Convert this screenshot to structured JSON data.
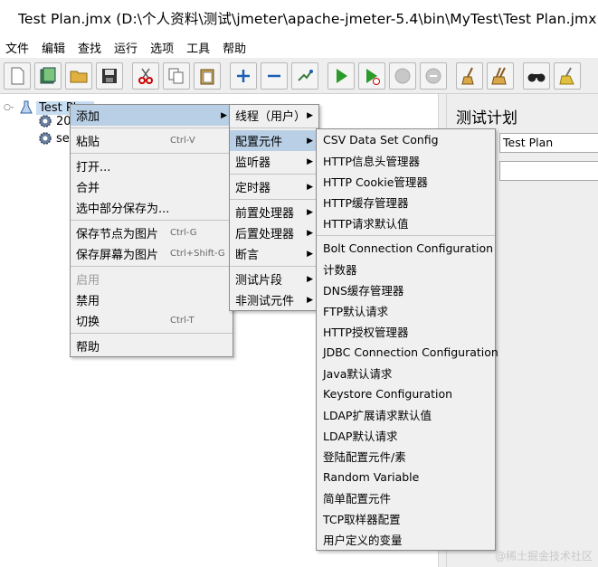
{
  "window": {
    "title": "Test Plan.jmx (D:\\个人资料\\测试\\jmeter\\apache-jmeter-5.4\\bin\\MyTest\\Test Plan.jmx) - A"
  },
  "menubar": [
    "文件",
    "编辑",
    "查找",
    "运行",
    "选项",
    "工具",
    "帮助"
  ],
  "toolbar": {
    "icons": [
      "new-icon",
      "templates-icon",
      "open-icon",
      "save-icon",
      "cut-icon",
      "copy-icon",
      "paste-icon",
      "expand-icon",
      "collapse-icon",
      "toggle-icon",
      "start-icon",
      "start-no-pause-icon",
      "stop-icon",
      "shutdown-icon",
      "clear-icon",
      "clear-all-icon",
      "search-icon",
      "reset-search-icon"
    ]
  },
  "tree": {
    "root": "Test Plan",
    "children": [
      "20",
      "se"
    ]
  },
  "right_panel": {
    "title": "测试计划",
    "name_value": "Test Plan",
    "comment_value": ""
  },
  "context_menu": [
    {
      "label": "添加",
      "submenu": true,
      "highlight": true
    },
    {
      "sep": true
    },
    {
      "label": "粘贴",
      "accel": "Ctrl-V"
    },
    {
      "sep": true
    },
    {
      "label": "打开..."
    },
    {
      "label": "合并"
    },
    {
      "label": "选中部分保存为..."
    },
    {
      "sep": true
    },
    {
      "label": "保存节点为图片",
      "accel": "Ctrl-G"
    },
    {
      "label": "保存屏幕为图片",
      "accel": "Ctrl+Shift-G"
    },
    {
      "sep": true
    },
    {
      "label": "启用",
      "disabled": true
    },
    {
      "label": "禁用"
    },
    {
      "label": "切换",
      "accel": "Ctrl-T"
    },
    {
      "sep": true
    },
    {
      "label": "帮助"
    }
  ],
  "add_submenu": [
    {
      "label": "线程（用户）",
      "submenu": true
    },
    {
      "sep": true
    },
    {
      "label": "配置元件",
      "submenu": true,
      "highlight": true
    },
    {
      "label": "监听器",
      "submenu": true
    },
    {
      "sep": true
    },
    {
      "label": "定时器",
      "submenu": true
    },
    {
      "sep": true
    },
    {
      "label": "前置处理器",
      "submenu": true
    },
    {
      "label": "后置处理器",
      "submenu": true
    },
    {
      "label": "断言",
      "submenu": true
    },
    {
      "sep": true
    },
    {
      "label": "测试片段",
      "submenu": true
    },
    {
      "label": "非测试元件",
      "submenu": true
    }
  ],
  "config_submenu": [
    {
      "label": "CSV Data Set Config"
    },
    {
      "label": "HTTP信息头管理器"
    },
    {
      "label": "HTTP Cookie管理器"
    },
    {
      "label": "HTTP缓存管理器"
    },
    {
      "label": "HTTP请求默认值"
    },
    {
      "sep": true
    },
    {
      "label": "Bolt Connection Configuration"
    },
    {
      "label": "计数器"
    },
    {
      "label": "DNS缓存管理器"
    },
    {
      "label": "FTP默认请求"
    },
    {
      "label": "HTTP授权管理器"
    },
    {
      "label": "JDBC Connection Configuration"
    },
    {
      "label": "Java默认请求"
    },
    {
      "label": "Keystore Configuration"
    },
    {
      "label": "LDAP扩展请求默认值"
    },
    {
      "label": "LDAP默认请求"
    },
    {
      "label": "登陆配置元件/素"
    },
    {
      "label": "Random Variable"
    },
    {
      "label": "简单配置元件"
    },
    {
      "label": "TCP取样器配置"
    },
    {
      "label": "用户定义的变量"
    }
  ],
  "watermark": "@稀土掘金技术社区"
}
